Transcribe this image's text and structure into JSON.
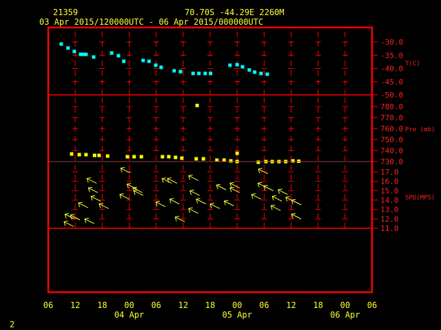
{
  "header": {
    "station": "21359",
    "location": "70.70S  -44.29E  2260M",
    "period": "03 Apr 2015/120000UTC - 06 Apr 2015/000000UTC"
  },
  "page_number": "2",
  "colors": {
    "frame": "#ff0000",
    "temperature": "#00ffff",
    "pressure": "#ffff00",
    "wind": "#ffff33",
    "text": "#ffff33"
  },
  "chart_data": {
    "type": "scatter",
    "x_unit": "hours since 03 Apr 06 UTC",
    "xlim": [
      0,
      72
    ],
    "x_ticks": [
      {
        "h": 0,
        "label": "06"
      },
      {
        "h": 6,
        "label": "12"
      },
      {
        "h": 12,
        "label": "18"
      },
      {
        "h": 18,
        "label": "00"
      },
      {
        "h": 24,
        "label": "06"
      },
      {
        "h": 30,
        "label": "12"
      },
      {
        "h": 36,
        "label": "18"
      },
      {
        "h": 42,
        "label": "00"
      },
      {
        "h": 48,
        "label": "06"
      },
      {
        "h": 54,
        "label": "12"
      },
      {
        "h": 60,
        "label": "18"
      },
      {
        "h": 66,
        "label": "00"
      },
      {
        "h": 72,
        "label": "06"
      }
    ],
    "date_labels": [
      {
        "h": 18,
        "label": "04 Apr"
      },
      {
        "h": 42,
        "label": "05 Apr"
      },
      {
        "h": 66,
        "label": "06 Apr"
      }
    ],
    "panels": [
      {
        "name": "temperature",
        "ylabel": "T(C)",
        "ylim": [
          -50,
          -30
        ],
        "ticks": [
          "-30.0",
          "-35.0",
          "-40.0",
          "-45.0",
          "-50.0"
        ],
        "tick_values": [
          -30,
          -35,
          -40,
          -45,
          -50
        ],
        "points": [
          [
            2.9,
            -30.8
          ],
          [
            4.4,
            -32.3
          ],
          [
            5.8,
            -33.6
          ],
          [
            7.2,
            -34.7
          ],
          [
            7.7,
            -34.7
          ],
          [
            8.4,
            -34.7
          ],
          [
            10.1,
            -35.7
          ],
          [
            14.1,
            -34.2
          ],
          [
            15.6,
            -35.2
          ],
          [
            16.8,
            -37.3
          ],
          [
            21.1,
            -37.0
          ],
          [
            22.4,
            -37.3
          ],
          [
            23.9,
            -38.8
          ],
          [
            25.1,
            -39.6
          ],
          [
            28.0,
            -40.9
          ],
          [
            29.4,
            -41.2
          ],
          [
            32.2,
            -41.9
          ],
          [
            33.5,
            -41.9
          ],
          [
            34.9,
            -41.9
          ],
          [
            36.1,
            -41.9
          ],
          [
            40.4,
            -38.8
          ],
          [
            42.0,
            -38.6
          ],
          [
            43.2,
            -39.4
          ],
          [
            44.7,
            -40.6
          ],
          [
            45.9,
            -41.4
          ],
          [
            47.3,
            -41.9
          ],
          [
            48.7,
            -42.2
          ]
        ]
      },
      {
        "name": "pressure",
        "ylabel": "Pre (mb)",
        "ylim": [
          730,
          780
        ],
        "ticks": [
          "780.0",
          "770.0",
          "760.0",
          "750.0",
          "740.0",
          "730.0"
        ],
        "tick_values": [
          780,
          770,
          760,
          750,
          740,
          730
        ],
        "points": [
          [
            5.2,
            736.9
          ],
          [
            6.9,
            736.3
          ],
          [
            8.4,
            736.3
          ],
          [
            10.3,
            735.6
          ],
          [
            11.3,
            735.6
          ],
          [
            13.2,
            735.0
          ],
          [
            17.6,
            734.4
          ],
          [
            19.1,
            734.4
          ],
          [
            20.7,
            734.4
          ],
          [
            25.4,
            734.4
          ],
          [
            26.8,
            734.4
          ],
          [
            28.3,
            733.8
          ],
          [
            29.7,
            733.1
          ],
          [
            33.1,
            781.0
          ],
          [
            32.9,
            732.5
          ],
          [
            34.5,
            732.5
          ],
          [
            37.5,
            731.3
          ],
          [
            39.1,
            731.3
          ],
          [
            40.6,
            730.6
          ],
          [
            42.0,
            737.5
          ],
          [
            42.0,
            730.0
          ],
          [
            46.7,
            729.4
          ],
          [
            48.4,
            730.0
          ],
          [
            49.8,
            730.0
          ],
          [
            51.3,
            730.0
          ],
          [
            52.8,
            730.0
          ],
          [
            54.4,
            730.6
          ],
          [
            55.7,
            730.3
          ]
        ]
      },
      {
        "name": "wind",
        "ylabel": "SPD(MPS)",
        "ylim": [
          11,
          17
        ],
        "ticks": [
          "17.0",
          "16.0",
          "15.0",
          "14.0",
          "13.0",
          "12.0",
          "11.0"
        ],
        "tick_values": [
          17,
          16,
          15,
          14,
          13,
          12,
          11
        ],
        "points": [
          [
            3.5,
            11.7
          ],
          [
            3.7,
            12.5
          ],
          [
            4.9,
            12.4
          ],
          [
            8.1,
            12.0
          ],
          [
            6.7,
            13.7
          ],
          [
            11.3,
            13.6
          ],
          [
            9.5,
            14.4
          ],
          [
            8.9,
            15.3
          ],
          [
            8.6,
            16.3
          ],
          [
            15.9,
            14.6
          ],
          [
            16.1,
            17.4
          ],
          [
            17.5,
            15.7
          ],
          [
            18.8,
            15.3
          ],
          [
            19.0,
            15.0
          ],
          [
            23.9,
            13.8
          ],
          [
            25.3,
            16.3
          ],
          [
            26.5,
            16.3
          ],
          [
            27.0,
            14.1
          ],
          [
            28.2,
            12.2
          ],
          [
            31.2,
            16.6
          ],
          [
            31.5,
            15.0
          ],
          [
            31.2,
            13.1
          ],
          [
            32.9,
            14.1
          ],
          [
            36.0,
            13.6
          ],
          [
            37.4,
            15.6
          ],
          [
            39.1,
            13.9
          ],
          [
            40.4,
            15.8
          ],
          [
            40.4,
            15.3
          ],
          [
            45.2,
            14.6
          ],
          [
            46.7,
            17.3
          ],
          [
            46.6,
            15.8
          ],
          [
            47.9,
            15.5
          ],
          [
            49.5,
            13.4
          ],
          [
            49.8,
            14.4
          ],
          [
            51.1,
            15.1
          ],
          [
            52.8,
            14.3
          ],
          [
            54.1,
            14.0
          ],
          [
            54.1,
            12.5
          ]
        ]
      }
    ]
  }
}
